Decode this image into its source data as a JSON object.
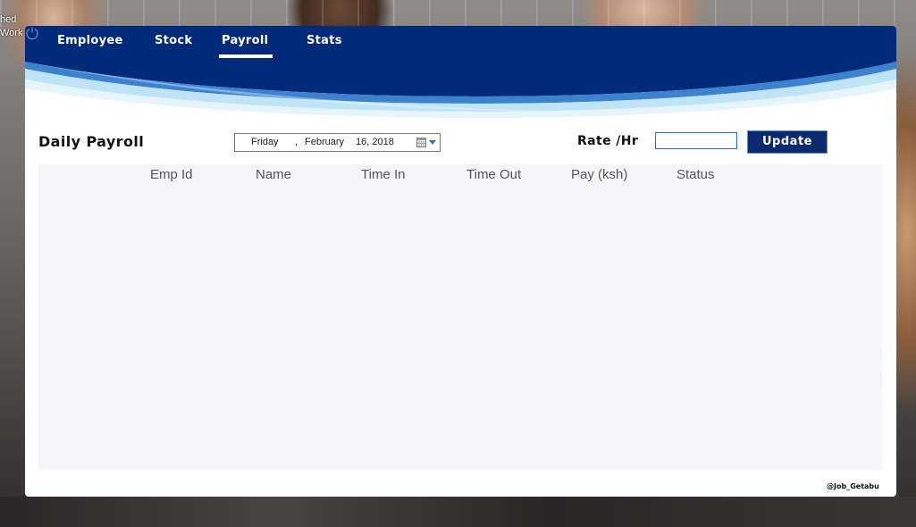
{
  "desktop": {
    "icon_label_lines": [
      "hed",
      "Work"
    ]
  },
  "nav": {
    "items": [
      {
        "label": "Employee"
      },
      {
        "label": "Stock"
      },
      {
        "label": "Payroll",
        "active": true
      },
      {
        "label": "Stats"
      }
    ],
    "power_icon": "power-icon"
  },
  "payroll": {
    "title": "Daily Payroll",
    "date": {
      "weekday": "Friday",
      "separator": ",",
      "month": "February",
      "day_year": "16, 2018"
    },
    "rate_label": "Rate /Hr",
    "rate_value": "",
    "update_label": "Update"
  },
  "table": {
    "columns": [
      "Emp Id",
      "Name",
      "Time In",
      "Time Out",
      "Pay (ksh)",
      "Status"
    ],
    "rows": []
  },
  "footer": {
    "watermark": "@Job_Getabu"
  },
  "colors": {
    "header_navy": "#022a7a",
    "accent_light_blue": "#bfe3f7",
    "button_navy": "#0b2a6d",
    "grid_background": "#f5f5f7"
  }
}
